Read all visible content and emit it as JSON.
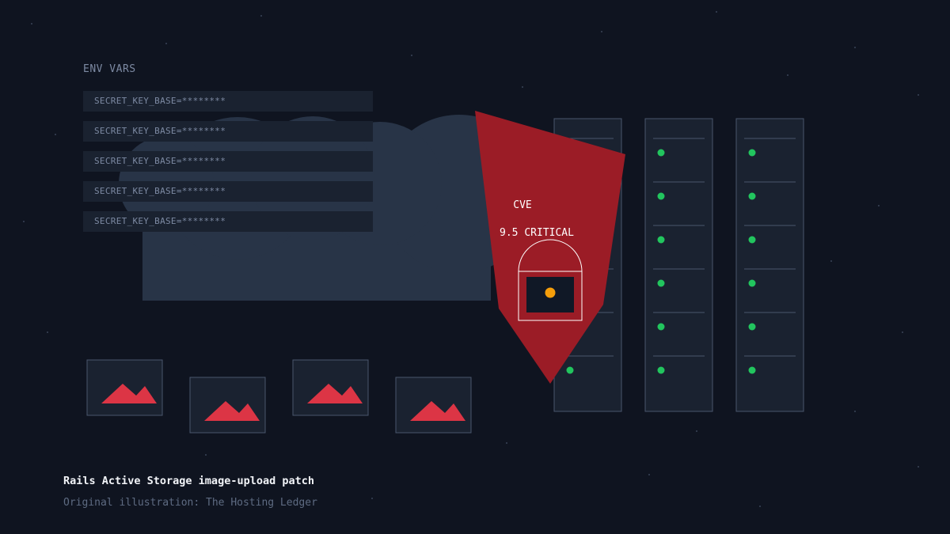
{
  "env": {
    "title": "ENV VARS",
    "rows": [
      "SECRET_KEY_BASE=********",
      "SECRET_KEY_BASE=********",
      "SECRET_KEY_BASE=********",
      "SECRET_KEY_BASE=********",
      "SECRET_KEY_BASE=********"
    ]
  },
  "shield": {
    "label": "CVE",
    "severity": "9.5 CRITICAL"
  },
  "caption": {
    "title": "Rails Active Storage image-upload patch",
    "credit": "Original illustration: The Hosting Ledger"
  },
  "colors": {
    "background": "#0f1420",
    "cloud": "#283447",
    "panel": "#1a2230",
    "shield_red": "#9b1c26",
    "status_green": "#22c55e",
    "alert_orange": "#f59e0b",
    "image_red": "#dc3545"
  },
  "icons": [
    "cloud-icon",
    "image-icon",
    "shield-icon",
    "lock-icon",
    "server-rack-icon",
    "status-dot-icon"
  ]
}
